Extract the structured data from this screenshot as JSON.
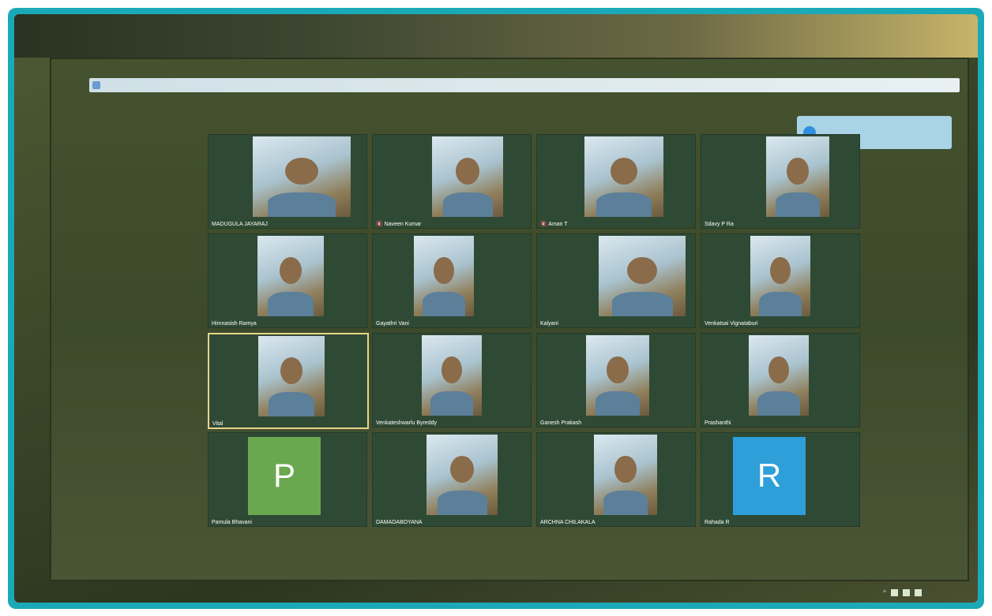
{
  "meeting": {
    "participants": [
      {
        "id": "p1",
        "name": "MADUGULA JAYARAJ",
        "type": "video"
      },
      {
        "id": "p2",
        "name": "Naveen Kumar",
        "type": "video",
        "muted": true
      },
      {
        "id": "p3",
        "name": "Aman T",
        "type": "video",
        "muted": true
      },
      {
        "id": "p4",
        "name": "Sdavy P Ra",
        "type": "video"
      },
      {
        "id": "p5",
        "name": "Himnasish Ramya",
        "type": "video"
      },
      {
        "id": "p6",
        "name": "Gayathri Vani",
        "type": "video"
      },
      {
        "id": "p7",
        "name": "Kalyani",
        "type": "video"
      },
      {
        "id": "p8",
        "name": "Venkatsai Vignataburi",
        "type": "video"
      },
      {
        "id": "p9",
        "name": "Vital",
        "type": "video",
        "active": true
      },
      {
        "id": "p10",
        "name": "Venkateshwarlu Byreddy",
        "type": "video"
      },
      {
        "id": "p11",
        "name": "Ganesh Prakash",
        "type": "video"
      },
      {
        "id": "p12",
        "name": "Prashanthi",
        "type": "video"
      },
      {
        "id": "p13",
        "name": "Pamula Bhavani",
        "type": "avatar",
        "letter": "P",
        "color": "#6aa84f"
      },
      {
        "id": "p14",
        "name": "DAMADABOYANA",
        "type": "video"
      },
      {
        "id": "p15",
        "name": "ARCHNA CHILAKALA",
        "type": "video"
      },
      {
        "id": "p16",
        "name": "Rahada R",
        "type": "avatar",
        "letter": "R",
        "color": "#2e9fd9"
      }
    ]
  },
  "taskbar": {
    "icons": [
      "windows-start-icon",
      "search-icon",
      "task-view-icon",
      "edge-browser-icon",
      "mail-icon",
      "chrome-icon",
      "zoom-icon",
      "teams-icon"
    ]
  },
  "colors": {
    "frame": "#1ba9b8",
    "tile_bg": "#2f4a34",
    "active_border": "#e9d48a"
  }
}
